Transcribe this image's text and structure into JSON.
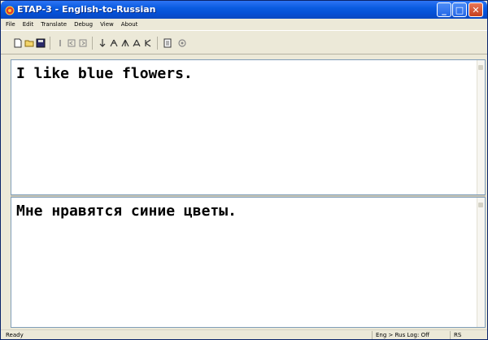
{
  "window": {
    "title": "ETAP-3 - English-to-Russian",
    "title_color": "#0a5be0"
  },
  "menu": {
    "items": [
      "File",
      "Edit",
      "Translate",
      "Debug",
      "View",
      "About"
    ]
  },
  "toolbar": {
    "icons": [
      "new-document-icon",
      "open-folder-icon",
      "save-disk-icon",
      "translate-sentence-icon",
      "translate-prev-icon",
      "translate-next-icon",
      "tree-down-icon",
      "syntax-tree-icon",
      "morphology-tree-icon",
      "semantic-tree-icon",
      "lexical-tree-icon",
      "dictionary-icon",
      "settings-icon"
    ]
  },
  "source_pane": {
    "text": "I like blue flowers."
  },
  "target_pane": {
    "text": "Мне нравятся синие цветы."
  },
  "statusbar": {
    "status": "Ready",
    "direction": "Eng > Rus Log: Off",
    "mode": "RS"
  }
}
